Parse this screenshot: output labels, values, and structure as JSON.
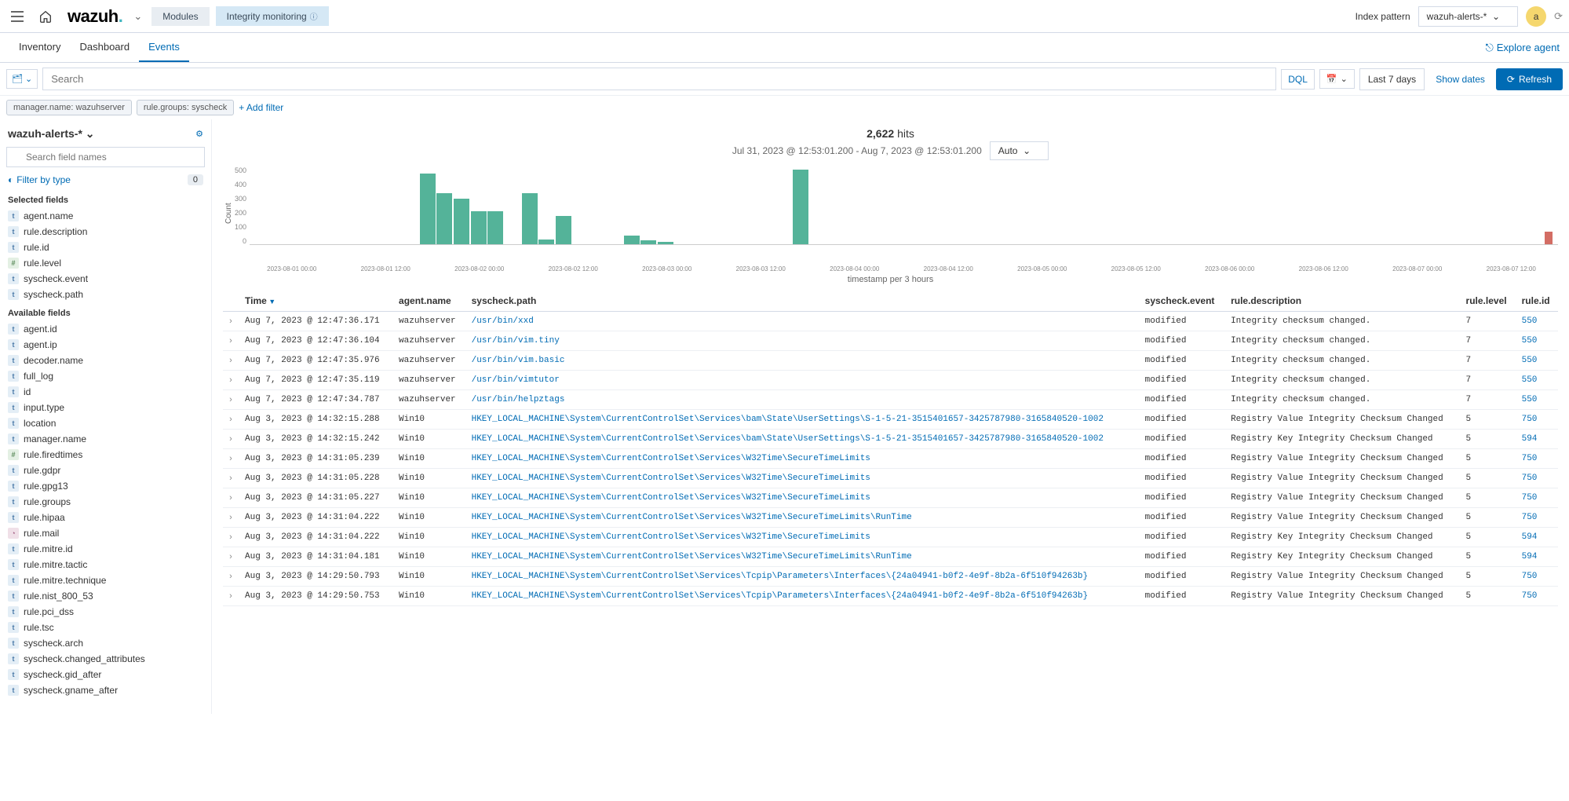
{
  "header": {
    "brand": "wazuh",
    "index_pattern_label": "Index pattern",
    "index_pattern_value": "wazuh-alerts-*",
    "avatar_letter": "a",
    "breadcrumbs": [
      "Modules",
      "Integrity monitoring"
    ]
  },
  "tabs": {
    "items": [
      "Inventory",
      "Dashboard",
      "Events"
    ],
    "active": "Events",
    "explore_agent": "Explore agent"
  },
  "search": {
    "placeholder": "Search",
    "dql": "DQL",
    "date_range": "Last 7 days",
    "show_dates": "Show dates",
    "refresh": "Refresh"
  },
  "filters": {
    "pills": [
      "manager.name: wazuhserver",
      "rule.groups: syscheck"
    ],
    "add_filter": "+ Add filter"
  },
  "sidebar": {
    "index_title": "wazuh-alerts-*",
    "search_placeholder": "Search field names",
    "filter_by_type": "Filter by type",
    "filter_count": "0",
    "selected_h": "Selected fields",
    "available_h": "Available fields",
    "selected": [
      {
        "icon": "t",
        "name": "agent.name"
      },
      {
        "icon": "t",
        "name": "rule.description"
      },
      {
        "icon": "t",
        "name": "rule.id"
      },
      {
        "icon": "n",
        "name": "rule.level"
      },
      {
        "icon": "t",
        "name": "syscheck.event"
      },
      {
        "icon": "t",
        "name": "syscheck.path"
      }
    ],
    "available": [
      {
        "icon": "t",
        "name": "agent.id"
      },
      {
        "icon": "t",
        "name": "agent.ip"
      },
      {
        "icon": "t",
        "name": "decoder.name"
      },
      {
        "icon": "t",
        "name": "full_log"
      },
      {
        "icon": "t",
        "name": "id"
      },
      {
        "icon": "t",
        "name": "input.type"
      },
      {
        "icon": "t",
        "name": "location"
      },
      {
        "icon": "t",
        "name": "manager.name"
      },
      {
        "icon": "n",
        "name": "rule.firedtimes"
      },
      {
        "icon": "t",
        "name": "rule.gdpr"
      },
      {
        "icon": "t",
        "name": "rule.gpg13"
      },
      {
        "icon": "t",
        "name": "rule.groups"
      },
      {
        "icon": "t",
        "name": "rule.hipaa"
      },
      {
        "icon": "c",
        "name": "rule.mail"
      },
      {
        "icon": "t",
        "name": "rule.mitre.id"
      },
      {
        "icon": "t",
        "name": "rule.mitre.tactic"
      },
      {
        "icon": "t",
        "name": "rule.mitre.technique"
      },
      {
        "icon": "t",
        "name": "rule.nist_800_53"
      },
      {
        "icon": "t",
        "name": "rule.pci_dss"
      },
      {
        "icon": "t",
        "name": "rule.tsc"
      },
      {
        "icon": "t",
        "name": "syscheck.arch"
      },
      {
        "icon": "t",
        "name": "syscheck.changed_attributes"
      },
      {
        "icon": "t",
        "name": "syscheck.gid_after"
      },
      {
        "icon": "t",
        "name": "syscheck.gname_after"
      }
    ]
  },
  "results": {
    "hits_num": "2,622",
    "hits_word": "hits",
    "date_span": "Jul 31, 2023 @ 12:53:01.200 - Aug 7, 2023 @ 12:53:01.200",
    "auto": "Auto",
    "y_label": "Count",
    "x_label": "timestamp per 3 hours"
  },
  "chart_data": {
    "type": "bar",
    "xlabel": "timestamp per 3 hours",
    "ylabel": "Count",
    "ylim": [
      0,
      550
    ],
    "yticks": [
      0,
      100,
      200,
      300,
      400,
      500
    ],
    "x_tick_labels": [
      "2023-08-01 00:00",
      "2023-08-01 12:00",
      "2023-08-02 00:00",
      "2023-08-02 12:00",
      "2023-08-03 00:00",
      "2023-08-03 12:00",
      "2023-08-04 00:00",
      "2023-08-04 12:00",
      "2023-08-05 00:00",
      "2023-08-05 12:00",
      "2023-08-06 00:00",
      "2023-08-06 12:00",
      "2023-08-07 00:00",
      "2023-08-07 12:00"
    ],
    "bars": [
      {
        "pos_pct": 13.0,
        "value": 500
      },
      {
        "pos_pct": 14.3,
        "value": 360
      },
      {
        "pos_pct": 15.6,
        "value": 320
      },
      {
        "pos_pct": 16.9,
        "value": 235
      },
      {
        "pos_pct": 18.2,
        "value": 235
      },
      {
        "pos_pct": 20.8,
        "value": 360
      },
      {
        "pos_pct": 22.1,
        "value": 35
      },
      {
        "pos_pct": 23.4,
        "value": 200
      },
      {
        "pos_pct": 28.6,
        "value": 60
      },
      {
        "pos_pct": 29.9,
        "value": 30
      },
      {
        "pos_pct": 31.2,
        "value": 15
      },
      {
        "pos_pct": 41.5,
        "value": 530
      },
      {
        "pos_pct": 99.0,
        "value": 90,
        "red": true
      }
    ]
  },
  "columns": [
    "Time",
    "agent.name",
    "syscheck.path",
    "syscheck.event",
    "rule.description",
    "rule.level",
    "rule.id"
  ],
  "rows": [
    {
      "time": "Aug 7, 2023 @ 12:47:36.171",
      "agent": "wazuhserver",
      "path": "/usr/bin/xxd",
      "event": "modified",
      "desc": "Integrity checksum changed.",
      "level": "7",
      "id": "550"
    },
    {
      "time": "Aug 7, 2023 @ 12:47:36.104",
      "agent": "wazuhserver",
      "path": "/usr/bin/vim.tiny",
      "event": "modified",
      "desc": "Integrity checksum changed.",
      "level": "7",
      "id": "550"
    },
    {
      "time": "Aug 7, 2023 @ 12:47:35.976",
      "agent": "wazuhserver",
      "path": "/usr/bin/vim.basic",
      "event": "modified",
      "desc": "Integrity checksum changed.",
      "level": "7",
      "id": "550"
    },
    {
      "time": "Aug 7, 2023 @ 12:47:35.119",
      "agent": "wazuhserver",
      "path": "/usr/bin/vimtutor",
      "event": "modified",
      "desc": "Integrity checksum changed.",
      "level": "7",
      "id": "550"
    },
    {
      "time": "Aug 7, 2023 @ 12:47:34.787",
      "agent": "wazuhserver",
      "path": "/usr/bin/helpztags",
      "event": "modified",
      "desc": "Integrity checksum changed.",
      "level": "7",
      "id": "550"
    },
    {
      "time": "Aug 3, 2023 @ 14:32:15.288",
      "agent": "Win10",
      "path": "HKEY_LOCAL_MACHINE\\System\\CurrentControlSet\\Services\\bam\\State\\UserSettings\\S-1-5-21-3515401657-3425787980-3165840520-1002",
      "event": "modified",
      "desc": "Registry Value Integrity Checksum Changed",
      "level": "5",
      "id": "750"
    },
    {
      "time": "Aug 3, 2023 @ 14:32:15.242",
      "agent": "Win10",
      "path": "HKEY_LOCAL_MACHINE\\System\\CurrentControlSet\\Services\\bam\\State\\UserSettings\\S-1-5-21-3515401657-3425787980-3165840520-1002",
      "event": "modified",
      "desc": "Registry Key Integrity Checksum Changed",
      "level": "5",
      "id": "594"
    },
    {
      "time": "Aug 3, 2023 @ 14:31:05.239",
      "agent": "Win10",
      "path": "HKEY_LOCAL_MACHINE\\System\\CurrentControlSet\\Services\\W32Time\\SecureTimeLimits",
      "event": "modified",
      "desc": "Registry Value Integrity Checksum Changed",
      "level": "5",
      "id": "750"
    },
    {
      "time": "Aug 3, 2023 @ 14:31:05.228",
      "agent": "Win10",
      "path": "HKEY_LOCAL_MACHINE\\System\\CurrentControlSet\\Services\\W32Time\\SecureTimeLimits",
      "event": "modified",
      "desc": "Registry Value Integrity Checksum Changed",
      "level": "5",
      "id": "750"
    },
    {
      "time": "Aug 3, 2023 @ 14:31:05.227",
      "agent": "Win10",
      "path": "HKEY_LOCAL_MACHINE\\System\\CurrentControlSet\\Services\\W32Time\\SecureTimeLimits",
      "event": "modified",
      "desc": "Registry Value Integrity Checksum Changed",
      "level": "5",
      "id": "750"
    },
    {
      "time": "Aug 3, 2023 @ 14:31:04.222",
      "agent": "Win10",
      "path": "HKEY_LOCAL_MACHINE\\System\\CurrentControlSet\\Services\\W32Time\\SecureTimeLimits\\RunTime",
      "event": "modified",
      "desc": "Registry Value Integrity Checksum Changed",
      "level": "5",
      "id": "750"
    },
    {
      "time": "Aug 3, 2023 @ 14:31:04.222",
      "agent": "Win10",
      "path": "HKEY_LOCAL_MACHINE\\System\\CurrentControlSet\\Services\\W32Time\\SecureTimeLimits",
      "event": "modified",
      "desc": "Registry Key Integrity Checksum Changed",
      "level": "5",
      "id": "594"
    },
    {
      "time": "Aug 3, 2023 @ 14:31:04.181",
      "agent": "Win10",
      "path": "HKEY_LOCAL_MACHINE\\System\\CurrentControlSet\\Services\\W32Time\\SecureTimeLimits\\RunTime",
      "event": "modified",
      "desc": "Registry Key Integrity Checksum Changed",
      "level": "5",
      "id": "594"
    },
    {
      "time": "Aug 3, 2023 @ 14:29:50.793",
      "agent": "Win10",
      "path": "HKEY_LOCAL_MACHINE\\System\\CurrentControlSet\\Services\\Tcpip\\Parameters\\Interfaces\\{24a04941-b0f2-4e9f-8b2a-6f510f94263b}",
      "event": "modified",
      "desc": "Registry Value Integrity Checksum Changed",
      "level": "5",
      "id": "750"
    },
    {
      "time": "Aug 3, 2023 @ 14:29:50.753",
      "agent": "Win10",
      "path": "HKEY_LOCAL_MACHINE\\System\\CurrentControlSet\\Services\\Tcpip\\Parameters\\Interfaces\\{24a04941-b0f2-4e9f-8b2a-6f510f94263b}",
      "event": "modified",
      "desc": "Registry Value Integrity Checksum Changed",
      "level": "5",
      "id": "750"
    }
  ]
}
